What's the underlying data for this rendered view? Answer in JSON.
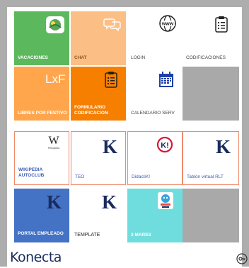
{
  "tiles": [
    {
      "label": "VACACIONES",
      "icon": "vacation-icon",
      "color": "#5cb85c"
    },
    {
      "label": "CHAT",
      "icon": "chat-bubbles-icon",
      "color": "#fbbf85"
    },
    {
      "label": "LOGIN",
      "icon": "globe-www-icon",
      "color": "#ffffff"
    },
    {
      "label": "CODIFICACIONES",
      "icon": "clipboard-icon",
      "color": "#ffffff"
    },
    {
      "label": "LIBRES POR FESTIVO",
      "icon": "lxf-logo",
      "icon_text": "LxF",
      "color": "#ffa64d"
    },
    {
      "label": "FORMULARIO CODIFICACION",
      "icon": "clipboard-icon",
      "color": "#f77f00"
    },
    {
      "label": "CALENDARIO SERV",
      "icon": "calendar-icon",
      "color": "#ffffff"
    },
    {
      "label": "",
      "icon": "",
      "color": "#a9a9a9"
    },
    {
      "label": "WIKIPEDIA AUTOCLUB",
      "icon": "wikipedia-icon",
      "icon_text": "W",
      "icon_subtext": "Wikipedia",
      "color": "#ffffff"
    },
    {
      "label": "TEO",
      "icon": "konecta-k-icon",
      "icon_text": "K",
      "color": "#ffffff"
    },
    {
      "label": "DidactiK!",
      "icon": "didactik-icon",
      "icon_text": "K!",
      "color": "#ffffff"
    },
    {
      "label": "Tablón virtual RLT",
      "icon": "konecta-k-icon",
      "icon_text": "K",
      "color": "#ffffff"
    },
    {
      "label": "PORTAL EMPLEADO",
      "icon": "konecta-k-icon",
      "icon_text": "K",
      "color": "#4472c4"
    },
    {
      "label": "TEMPLATE",
      "icon": "konecta-k-icon",
      "icon_text": "K",
      "color": "#ffffff"
    },
    {
      "label": "2 MARES",
      "icon": "mascot-icon",
      "color": "#6fdddd"
    },
    {
      "label": "",
      "icon": "",
      "color": "#a9a9a9"
    }
  ],
  "footer": {
    "brand": "Konecta",
    "action_icon": "key-icon"
  }
}
